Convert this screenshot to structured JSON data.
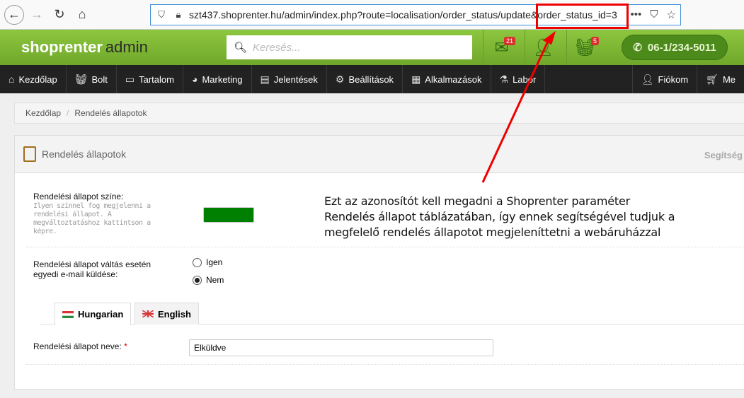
{
  "browser": {
    "url": "szt437.shoprenter.hu/admin/index.php?route=localisation/order_status/update&order_status_id=3"
  },
  "topbar": {
    "logo": "shoprenter",
    "logo_suffix": "admin",
    "search_placeholder": "Keresés...",
    "mail_count": "21",
    "cart_count": "5",
    "phone": "06-1/234-5011"
  },
  "menu": [
    {
      "label": "Kezdőlap",
      "icon": "home-icon"
    },
    {
      "label": "Bolt",
      "icon": "basket-icon"
    },
    {
      "label": "Tartalom",
      "icon": "laptop-icon"
    },
    {
      "label": "Marketing",
      "icon": "pie-chart-icon"
    },
    {
      "label": "Jelentések",
      "icon": "document-icon"
    },
    {
      "label": "Beállítások",
      "icon": "gear-icon"
    },
    {
      "label": "Alkalmazások",
      "icon": "grid-icon"
    },
    {
      "label": "Labor",
      "icon": "flask-icon"
    },
    {
      "label": "Fiókom",
      "icon": "user-icon"
    },
    {
      "label": "Me",
      "icon": "cart-icon"
    }
  ],
  "breadcrumb": [
    "Kezdőlap",
    "Rendelés állapotok"
  ],
  "panel": {
    "title": "Rendelés állapotok",
    "help": "Segítség",
    "color_label": "Rendelési állapot színe:",
    "color_hint": "Ilyen színnel fog megjelenni a rendelési állapot. A megváltoztatáshoz kattintson a képre.",
    "color_value": "#008000",
    "email_label": "Rendelési állapot váltás esetén egyedi e-mail küldése:",
    "radio_yes": "Igen",
    "radio_no": "Nem",
    "selected": "Nem",
    "tabs": [
      "Hungarian",
      "English"
    ],
    "name_label": "Rendelési állapot neve:",
    "required": "*",
    "name_value": "Elküldve"
  },
  "annotation": {
    "lines": [
      "Ezt az azonosítót kell megadni a Shoprenter paraméter",
      "Rendelés állapot táblázatában, így ennek segítségével tudjuk a",
      "megfelelő rendelés állapotot megjeleníttetni a webáruházzal"
    ],
    "color": "#ee0000"
  }
}
